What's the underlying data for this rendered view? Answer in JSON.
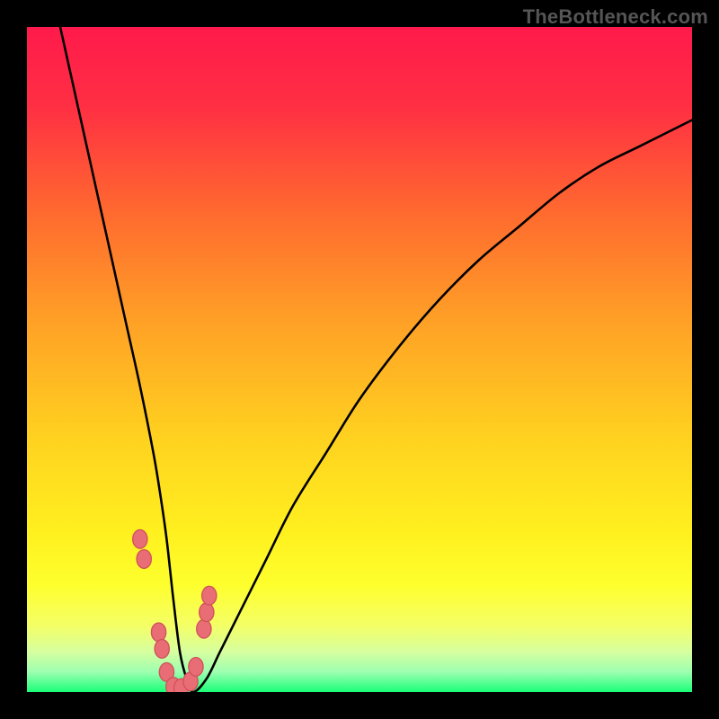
{
  "watermark": "TheBottleneck.com",
  "gradient_stops": [
    {
      "offset": 0.0,
      "color": "#ff1a4b"
    },
    {
      "offset": 0.12,
      "color": "#ff2f43"
    },
    {
      "offset": 0.28,
      "color": "#ff6a2f"
    },
    {
      "offset": 0.45,
      "color": "#ffa326"
    },
    {
      "offset": 0.62,
      "color": "#ffd21f"
    },
    {
      "offset": 0.76,
      "color": "#fff01f"
    },
    {
      "offset": 0.84,
      "color": "#feff2e"
    },
    {
      "offset": 0.9,
      "color": "#f4ff66"
    },
    {
      "offset": 0.94,
      "color": "#d6ffa0"
    },
    {
      "offset": 0.97,
      "color": "#9cffb0"
    },
    {
      "offset": 1.0,
      "color": "#19ff77"
    }
  ],
  "curve_color": "#000000",
  "dot_fill": "#e96d75",
  "dot_stroke": "#d0525c",
  "chart_data": {
    "type": "line",
    "title": "",
    "xlabel": "",
    "ylabel": "",
    "xlim": [
      0,
      100
    ],
    "ylim": [
      0,
      100
    ],
    "series": [
      {
        "name": "bottleneck-curve",
        "x": [
          5,
          7,
          9,
          11,
          13,
          15,
          17,
          19,
          20,
          21,
          22,
          23,
          24,
          25,
          27,
          29,
          32,
          36,
          40,
          45,
          50,
          56,
          62,
          68,
          74,
          80,
          86,
          92,
          98,
          100
        ],
        "y": [
          100,
          91,
          82,
          73,
          64,
          55,
          46,
          36,
          30,
          23,
          14,
          6,
          2,
          0,
          2,
          6,
          12,
          20,
          28,
          36,
          44,
          52,
          59,
          65,
          70,
          75,
          79,
          82,
          85,
          86
        ]
      }
    ],
    "highlight_points": {
      "name": "near-zero-dots",
      "x": [
        17.0,
        17.6,
        19.8,
        20.3,
        21.0,
        22.0,
        23.2,
        24.6,
        25.4,
        26.6,
        27.0,
        27.4
      ],
      "y": [
        23.0,
        20.0,
        9.0,
        6.5,
        3.0,
        0.8,
        0.6,
        1.6,
        3.8,
        9.5,
        12.0,
        14.5
      ]
    }
  }
}
